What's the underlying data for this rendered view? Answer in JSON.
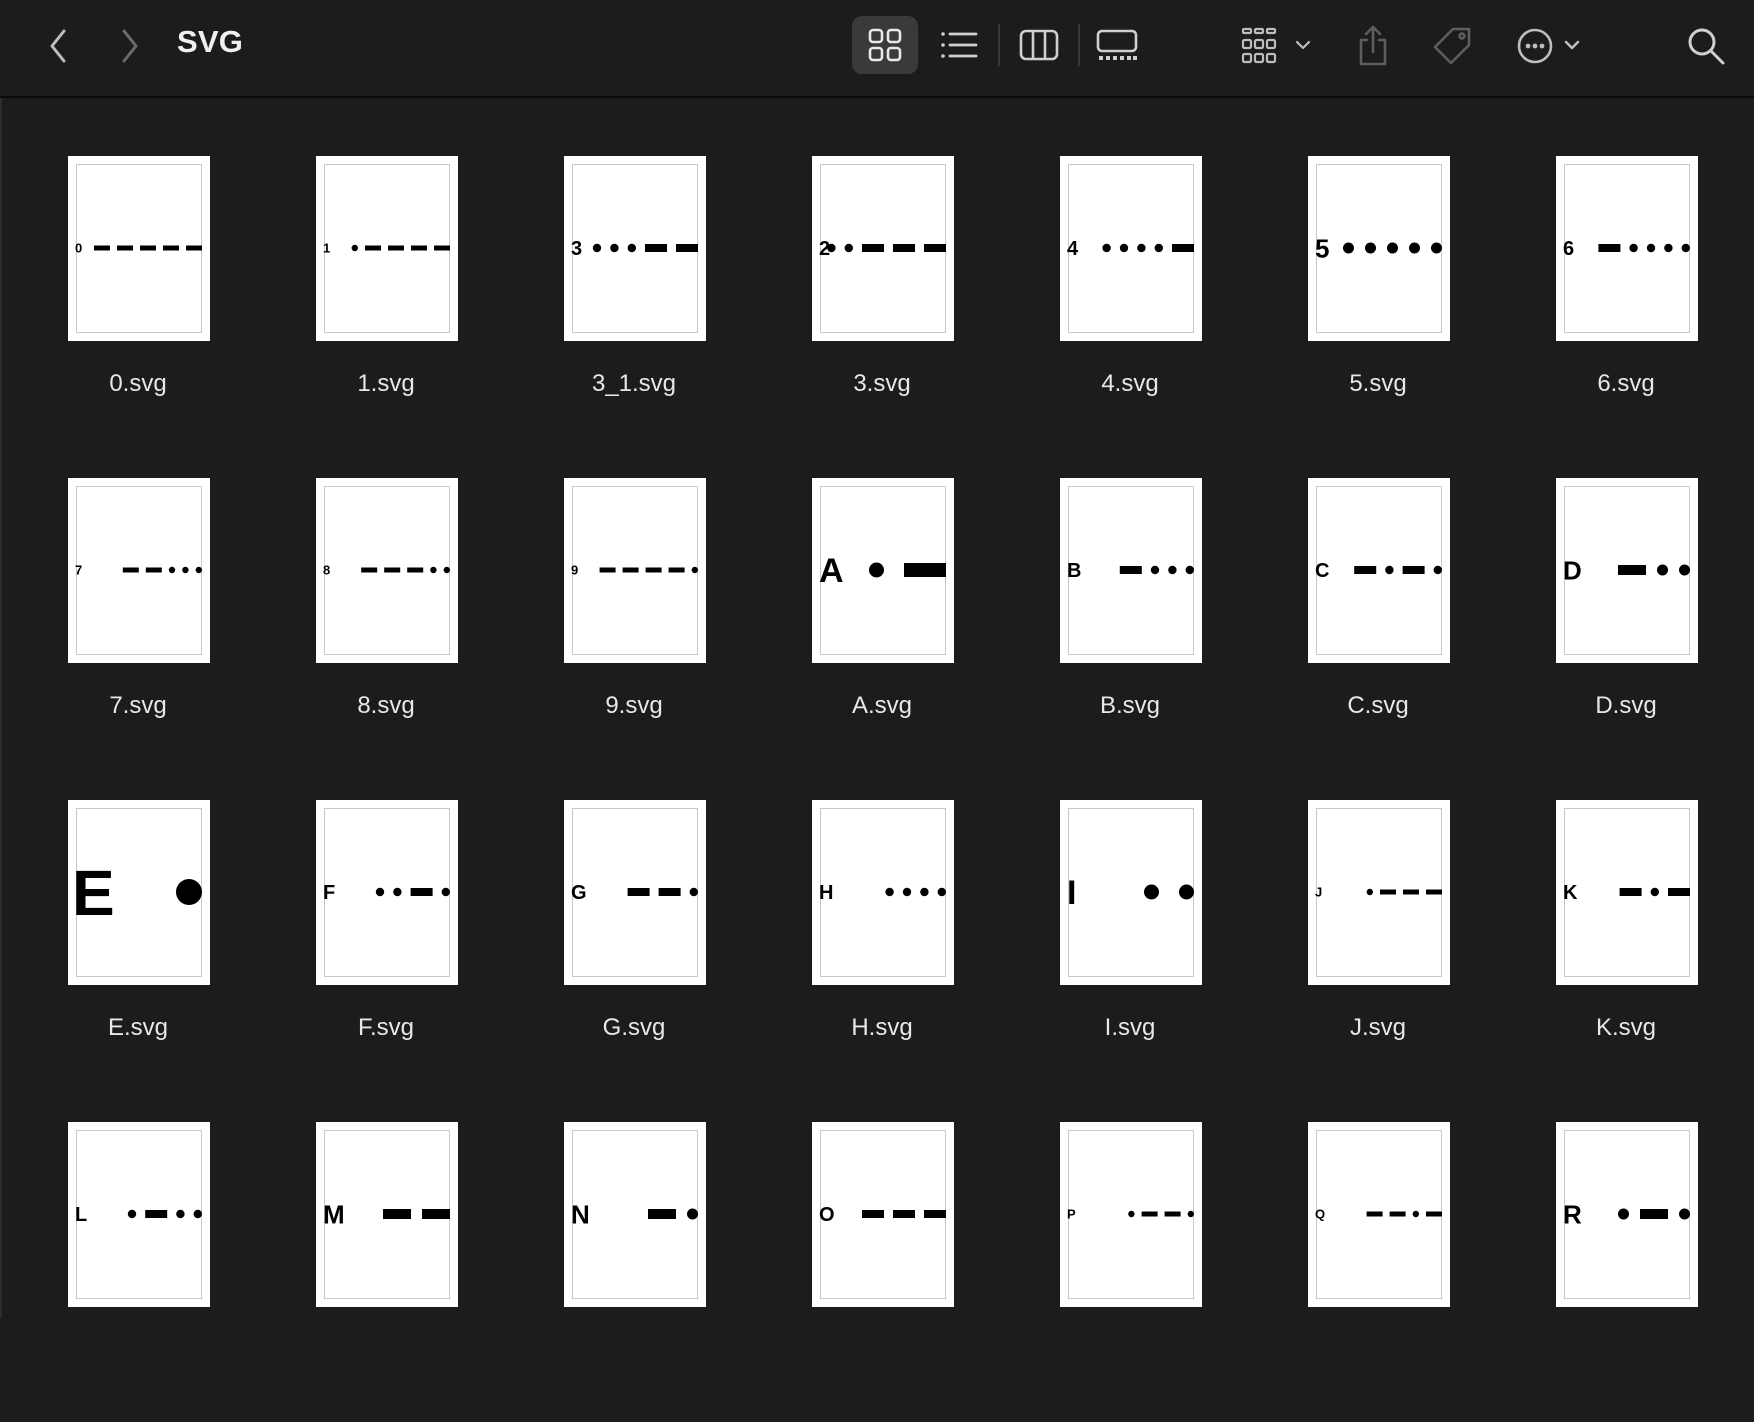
{
  "window": {
    "title": "SVG"
  },
  "toolbar": {
    "icons": [
      "chevron-left-icon",
      "chevron-right-icon",
      "grid-view-icon",
      "list-view-icon",
      "column-view-icon",
      "gallery-view-icon",
      "group-icon",
      "share-icon",
      "tag-icon",
      "more-icon",
      "search-icon"
    ]
  },
  "files": [
    {
      "name": "0.svg",
      "label": "0",
      "code": "-----",
      "size": "s"
    },
    {
      "name": "1.svg",
      "label": "1",
      "code": ".----",
      "size": "s"
    },
    {
      "name": "3_1.svg",
      "label": "3",
      "code": "...--",
      "size": "m"
    },
    {
      "name": "3.svg",
      "label": "2",
      "code": "..---",
      "size": "m"
    },
    {
      "name": "4.svg",
      "label": "4",
      "code": "....-",
      "size": "m"
    },
    {
      "name": "5.svg",
      "label": "5",
      "code": ".....",
      "size": "l"
    },
    {
      "name": "6.svg",
      "label": "6",
      "code": "-....",
      "size": "m"
    },
    {
      "name": "7.svg",
      "label": "7",
      "code": "--...",
      "size": "s"
    },
    {
      "name": "8.svg",
      "label": "8",
      "code": "---..",
      "size": "s"
    },
    {
      "name": "9.svg",
      "label": "9",
      "code": "----.",
      "size": "s"
    },
    {
      "name": "A.svg",
      "label": "A",
      "code": ".-",
      "size": "xl"
    },
    {
      "name": "B.svg",
      "label": "B",
      "code": "-...",
      "size": "m"
    },
    {
      "name": "C.svg",
      "label": "C",
      "code": "-.-.",
      "size": "m"
    },
    {
      "name": "D.svg",
      "label": "D",
      "code": "-..",
      "size": "l"
    },
    {
      "name": "E.svg",
      "label": "E",
      "code": ".",
      "size": "xxl"
    },
    {
      "name": "F.svg",
      "label": "F",
      "code": "..-.",
      "size": "m"
    },
    {
      "name": "G.svg",
      "label": "G",
      "code": "--.",
      "size": "m"
    },
    {
      "name": "H.svg",
      "label": "H",
      "code": "....",
      "size": "m"
    },
    {
      "name": "I.svg",
      "label": "I",
      "code": "..",
      "size": "xl"
    },
    {
      "name": "J.svg",
      "label": "J",
      "code": ".---",
      "size": "s"
    },
    {
      "name": "K.svg",
      "label": "K",
      "code": "-.-",
      "size": "m"
    },
    {
      "name": "",
      "label": "L",
      "code": ".-..",
      "size": "m"
    },
    {
      "name": "",
      "label": "M",
      "code": "--",
      "size": "l"
    },
    {
      "name": "",
      "label": "N",
      "code": "-.",
      "size": "l"
    },
    {
      "name": "",
      "label": "O",
      "code": "---",
      "size": "m"
    },
    {
      "name": "",
      "label": "P",
      "code": ".--.",
      "size": "s"
    },
    {
      "name": "",
      "label": "Q",
      "code": "--.-",
      "size": "s"
    },
    {
      "name": "",
      "label": "R",
      "code": ".-.",
      "size": "l"
    }
  ]
}
